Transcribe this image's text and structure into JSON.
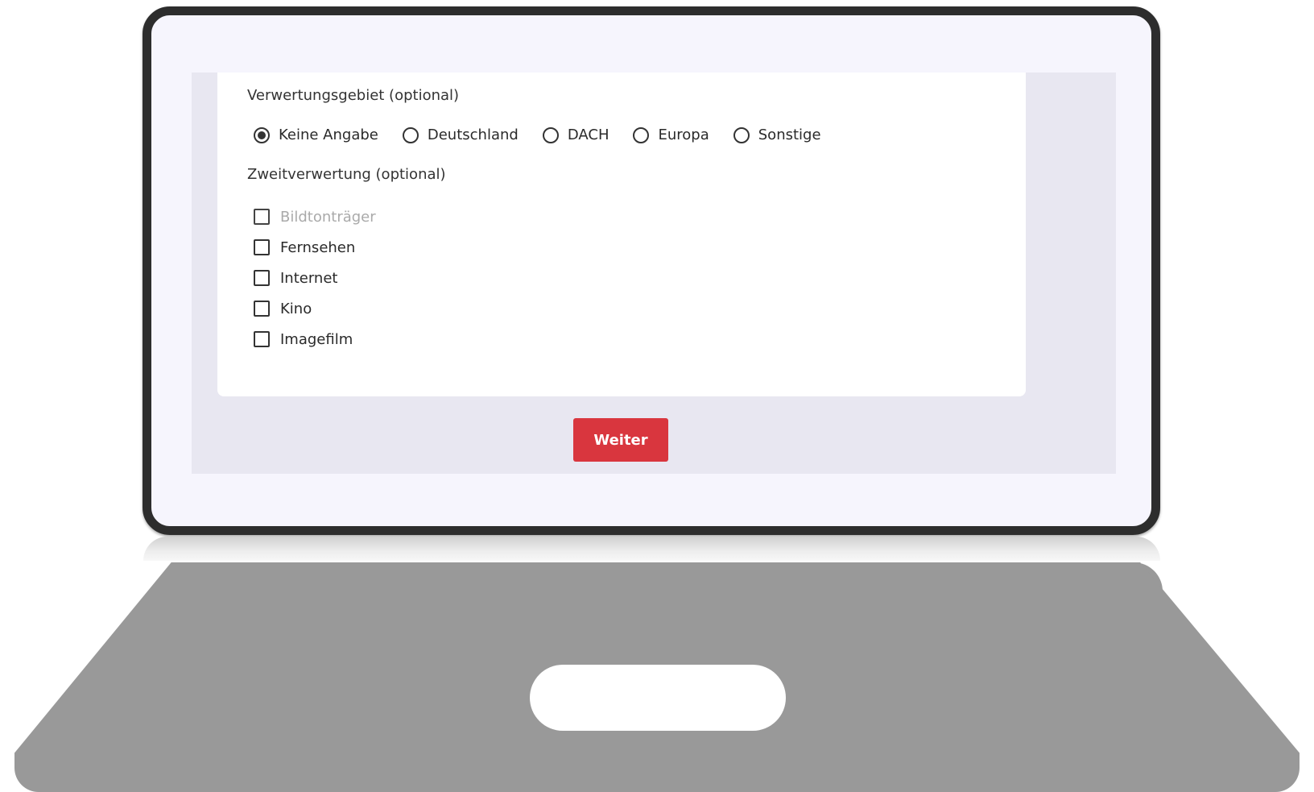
{
  "form": {
    "territory": {
      "label": "Verwertungsgebiet (optional)",
      "options": [
        "Keine Angabe",
        "Deutschland",
        "DACH",
        "Europa",
        "Sonstige"
      ],
      "selected": "Keine Angabe"
    },
    "secondary": {
      "label": "Zweitverwertung (optional)",
      "options": [
        {
          "label": "Bildtonträger",
          "checked": false,
          "disabled": true
        },
        {
          "label": "Fernsehen",
          "checked": false,
          "disabled": false
        },
        {
          "label": "Internet",
          "checked": false,
          "disabled": false
        },
        {
          "label": "Kino",
          "checked": false,
          "disabled": false
        },
        {
          "label": "Imagefilm",
          "checked": false,
          "disabled": false
        }
      ]
    },
    "next_label": "Weiter"
  },
  "colors": {
    "accent": "#d9363e",
    "screen_bg": "#e8e7f1",
    "card_bg": "#ffffff",
    "disabled_text": "#aaaaaa"
  }
}
